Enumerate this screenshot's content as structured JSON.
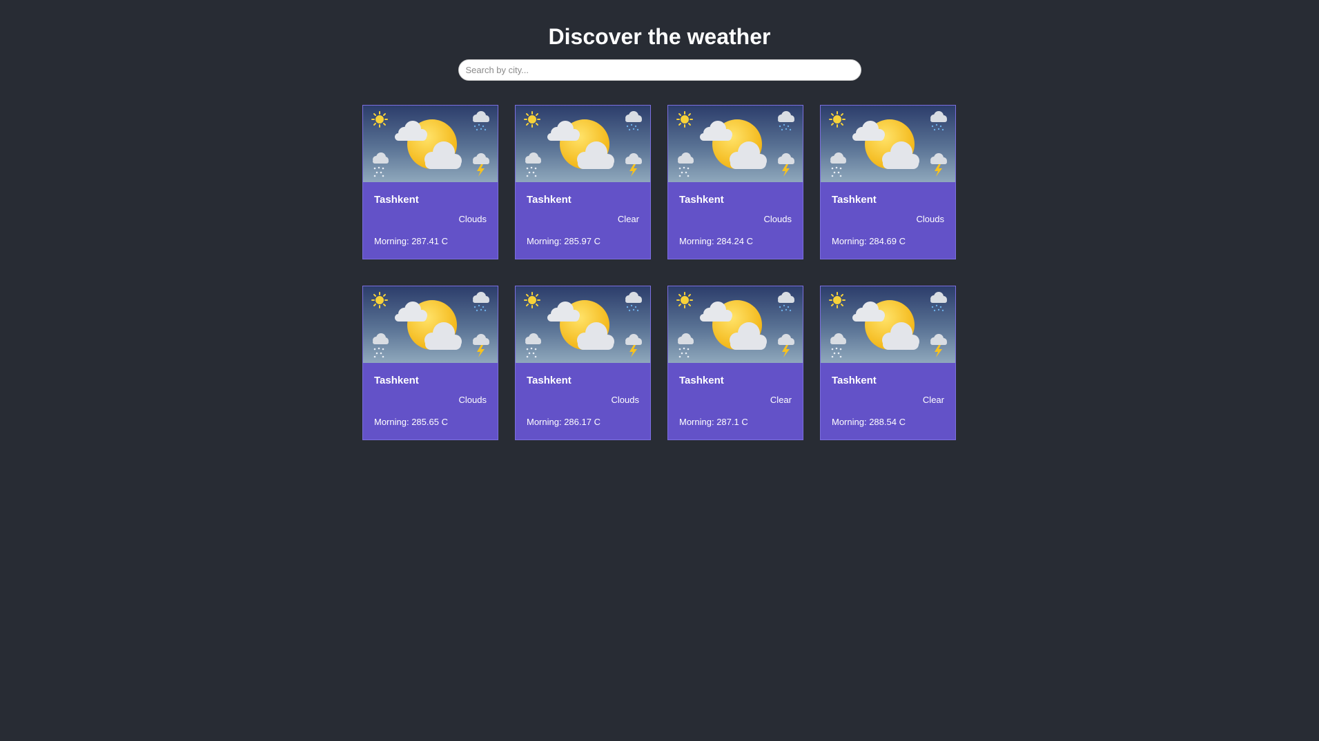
{
  "header": {
    "title": "Discover the weather"
  },
  "search": {
    "placeholder": "Search by city..."
  },
  "colors": {
    "background": "#282c34",
    "card": "#6352c8",
    "sun": "#f7c21f"
  },
  "cards": [
    {
      "city": "Tashkent",
      "condition": "Clouds",
      "morning": "Morning: 287.41 C",
      "image_icon": "weather-illustration-icon"
    },
    {
      "city": "Tashkent",
      "condition": "Clear",
      "morning": "Morning: 285.97 C",
      "image_icon": "weather-illustration-icon"
    },
    {
      "city": "Tashkent",
      "condition": "Clouds",
      "morning": "Morning: 284.24 C",
      "image_icon": "weather-illustration-icon"
    },
    {
      "city": "Tashkent",
      "condition": "Clouds",
      "morning": "Morning: 284.69 C",
      "image_icon": "weather-illustration-icon"
    },
    {
      "city": "Tashkent",
      "condition": "Clouds",
      "morning": "Morning: 285.65 C",
      "image_icon": "weather-illustration-icon"
    },
    {
      "city": "Tashkent",
      "condition": "Clouds",
      "morning": "Morning: 286.17 C",
      "image_icon": "weather-illustration-icon"
    },
    {
      "city": "Tashkent",
      "condition": "Clear",
      "morning": "Morning: 287.1 C",
      "image_icon": "weather-illustration-icon"
    },
    {
      "city": "Tashkent",
      "condition": "Clear",
      "morning": "Morning: 288.54 C",
      "image_icon": "weather-illustration-icon"
    }
  ]
}
